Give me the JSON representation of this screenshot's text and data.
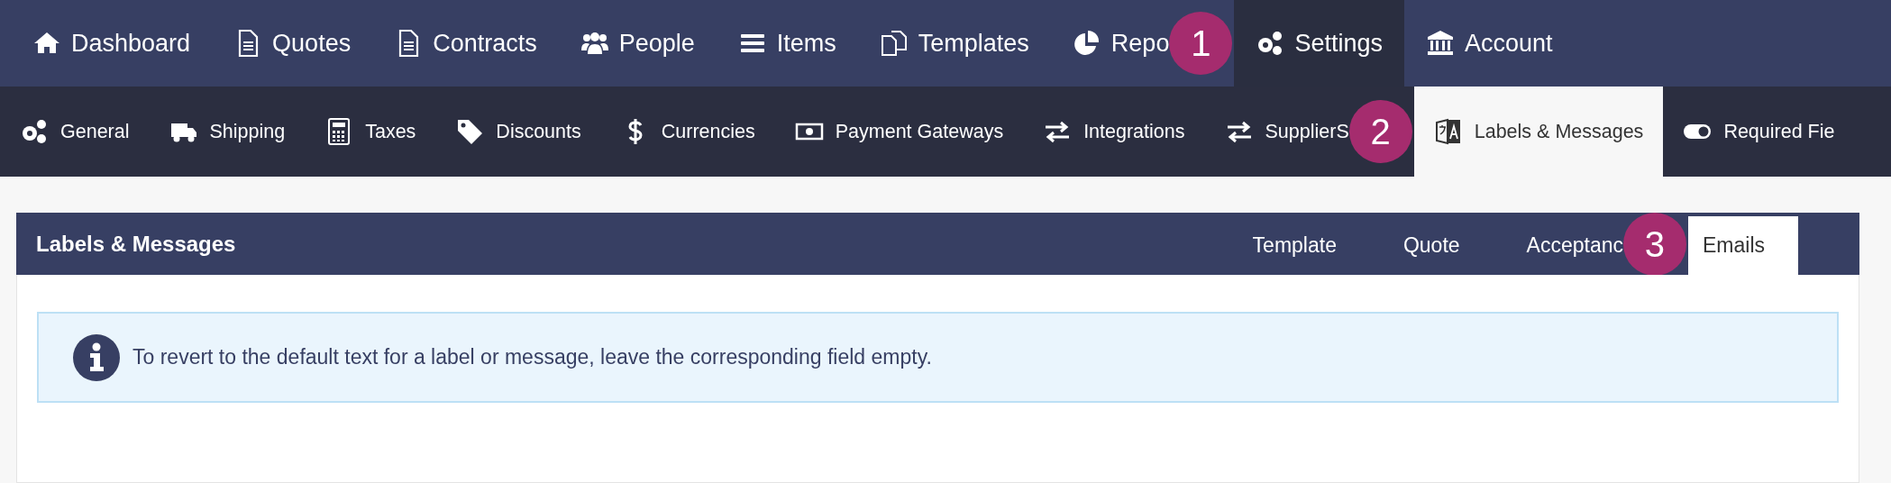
{
  "main_nav": [
    {
      "label": "Dashboard",
      "selected": false
    },
    {
      "label": "Quotes",
      "selected": false
    },
    {
      "label": "Contracts",
      "selected": false
    },
    {
      "label": "People",
      "selected": false
    },
    {
      "label": "Items",
      "selected": false
    },
    {
      "label": "Templates",
      "selected": false
    },
    {
      "label": "Repo",
      "selected": false,
      "step_badge": "1"
    },
    {
      "label": "Settings",
      "selected": true
    },
    {
      "label": "Account",
      "selected": false
    }
  ],
  "settings_nav": [
    {
      "label": "General",
      "selected": false
    },
    {
      "label": "Shipping",
      "selected": false
    },
    {
      "label": "Taxes",
      "selected": false
    },
    {
      "label": "Discounts",
      "selected": false
    },
    {
      "label": "Currencies",
      "selected": false
    },
    {
      "label": "Payment Gateways",
      "selected": false
    },
    {
      "label": "Integrations",
      "selected": false
    },
    {
      "label": "SupplierS",
      "selected": false,
      "step_badge": "2"
    },
    {
      "label": "Labels & Messages",
      "selected": true
    },
    {
      "label": "Required Fie",
      "selected": false
    }
  ],
  "panel": {
    "title": "Labels & Messages",
    "tabs": [
      {
        "label": "Template",
        "selected": false
      },
      {
        "label": "Quote",
        "selected": false
      },
      {
        "label": "Acceptanc",
        "selected": false,
        "step_badge": "3"
      },
      {
        "label": "Emails",
        "selected": true
      }
    ],
    "info": "To revert to the default text for a label or message, leave the corresponding field empty."
  }
}
